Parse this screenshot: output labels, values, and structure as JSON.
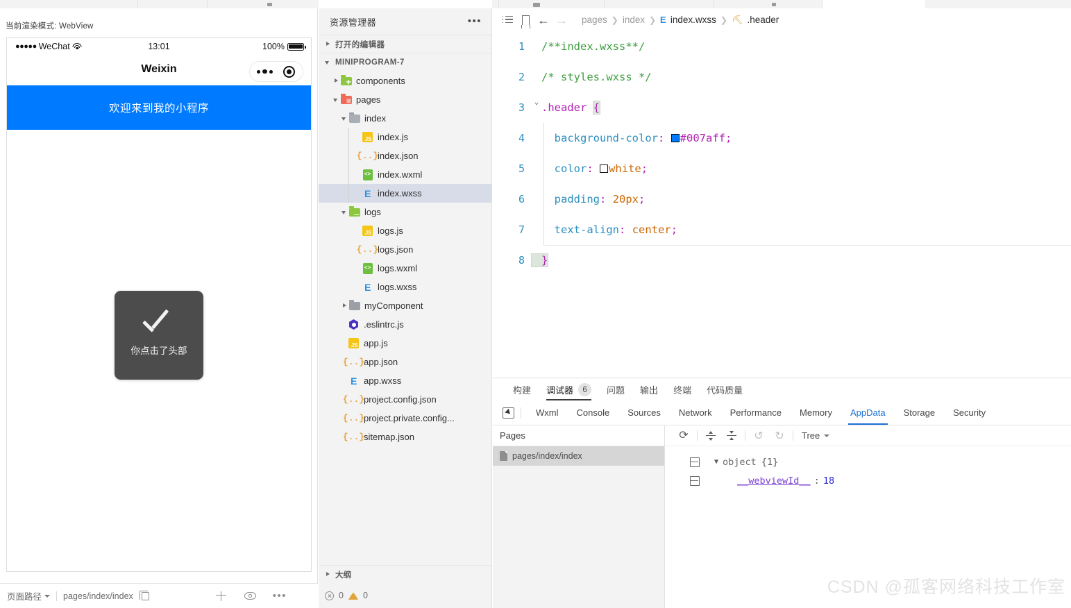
{
  "simulator": {
    "render_mode_label": "当前渲染模式: WebView",
    "status_bar": {
      "carrier": "WeChat",
      "dots": "●●●●●",
      "time": "13:01",
      "battery": "100%"
    },
    "nav_title": "Weixin",
    "header_banner": "欢迎来到我的小程序",
    "header_bg_color": "#007aff",
    "toast": {
      "icon": "check-icon",
      "text": "你点击了头部"
    },
    "bottom_bar": {
      "path_label": "页面路径",
      "path_value": "pages/index/index",
      "copy_icon": "copy-icon",
      "bug_icon": "bug-icon",
      "eye_icon": "eye-icon",
      "more_icon": "more-icon"
    }
  },
  "explorer": {
    "title": "资源管理器",
    "more_icon": "more-icon",
    "open_editors_label": "打开的编辑器",
    "project_label": "MINIPROGRAM-7",
    "outline_label": "大纲",
    "status": {
      "error_count": "0",
      "warning_count": "0"
    },
    "tree": [
      {
        "label": "components",
        "type": "folder",
        "icon": "folder-components-icon",
        "depth": 1,
        "expanded": false
      },
      {
        "label": "pages",
        "type": "folder",
        "icon": "folder-pages-icon",
        "depth": 1,
        "expanded": true
      },
      {
        "label": "index",
        "type": "folder",
        "icon": "folder-icon",
        "depth": 2,
        "expanded": true
      },
      {
        "label": "index.js",
        "type": "file",
        "icon": "js-icon",
        "depth": 3,
        "expanded": null
      },
      {
        "label": "index.json",
        "type": "file",
        "icon": "json-icon",
        "depth": 3,
        "expanded": null
      },
      {
        "label": "index.wxml",
        "type": "file",
        "icon": "wxml-icon",
        "depth": 3,
        "expanded": null
      },
      {
        "label": "index.wxss",
        "type": "file",
        "icon": "wxss-icon",
        "depth": 3,
        "expanded": null,
        "selected": true
      },
      {
        "label": "logs",
        "type": "folder",
        "icon": "folder-logs-icon",
        "depth": 2,
        "expanded": true
      },
      {
        "label": "logs.js",
        "type": "file",
        "icon": "js-icon",
        "depth": 3,
        "expanded": null
      },
      {
        "label": "logs.json",
        "type": "file",
        "icon": "json-icon",
        "depth": 3,
        "expanded": null
      },
      {
        "label": "logs.wxml",
        "type": "file",
        "icon": "wxml-icon",
        "depth": 3,
        "expanded": null
      },
      {
        "label": "logs.wxss",
        "type": "file",
        "icon": "wxss-icon",
        "depth": 3,
        "expanded": null
      },
      {
        "label": "myComponent",
        "type": "folder",
        "icon": "folder-icon",
        "depth": 2,
        "expanded": false
      },
      {
        "label": ".eslintrc.js",
        "type": "file",
        "icon": "eslint-icon",
        "depth": 1,
        "expanded": null
      },
      {
        "label": "app.js",
        "type": "file",
        "icon": "js-icon",
        "depth": 1,
        "expanded": null
      },
      {
        "label": "app.json",
        "type": "file",
        "icon": "json-icon",
        "depth": 1,
        "expanded": null
      },
      {
        "label": "app.wxss",
        "type": "file",
        "icon": "wxss-icon",
        "depth": 1,
        "expanded": null
      },
      {
        "label": "project.config.json",
        "type": "file",
        "icon": "json-icon",
        "depth": 1,
        "expanded": null
      },
      {
        "label": "project.private.config...",
        "type": "file",
        "icon": "json-icon",
        "depth": 1,
        "expanded": null
      },
      {
        "label": "sitemap.json",
        "type": "file",
        "icon": "json-icon",
        "depth": 1,
        "expanded": null
      }
    ]
  },
  "editor": {
    "toolbar_icons": [
      "list-icon",
      "bookmark-icon",
      "back-arrow-icon",
      "forward-arrow-icon"
    ],
    "breadcrumb": [
      {
        "label": "pages",
        "icon": null,
        "current": false
      },
      {
        "label": "index",
        "icon": null,
        "current": false
      },
      {
        "label": "index.wxss",
        "icon": "wxss-icon",
        "current": true
      },
      {
        "label": ".header",
        "icon": "css-rule-icon",
        "current": true
      }
    ],
    "lines": [
      {
        "num": "1",
        "text": "/**index.wxss**/"
      },
      {
        "num": "2",
        "text": "/* styles.wxss */"
      },
      {
        "num": "3",
        "text": ".header {"
      },
      {
        "num": "4",
        "text": "  background-color: #007aff;"
      },
      {
        "num": "5",
        "text": "  color: white;"
      },
      {
        "num": "6",
        "text": "  padding: 20px;"
      },
      {
        "num": "7",
        "text": "  text-align: center;"
      },
      {
        "num": "8",
        "text": "}"
      }
    ],
    "tokens": {
      "comment1": "/**index.wxss**/",
      "comment2": "/* styles.wxss */",
      "selector": ".header",
      "open_brace": "{",
      "close_brace": "}",
      "prop_bg": "background-color",
      "val_bg": "#007aff",
      "prop_color": "color",
      "val_color": "white",
      "prop_padding": "padding",
      "val_padding": "20px",
      "prop_align": "text-align",
      "val_align": "center",
      "colon": ":",
      "semicolon": ";",
      "swatch_bg_color": "#007aff",
      "swatch_white_color": "#ffffff"
    }
  },
  "debugger": {
    "panel_tabs": [
      {
        "label": "构建",
        "active": false,
        "badge": null
      },
      {
        "label": "调试器",
        "active": true,
        "badge": "6"
      },
      {
        "label": "问题",
        "active": false,
        "badge": null
      },
      {
        "label": "输出",
        "active": false,
        "badge": null
      },
      {
        "label": "终端",
        "active": false,
        "badge": null
      },
      {
        "label": "代码质量",
        "active": false,
        "badge": null
      }
    ],
    "devtools_tabs": [
      {
        "label": "Wxml",
        "active": false
      },
      {
        "label": "Console",
        "active": false
      },
      {
        "label": "Sources",
        "active": false
      },
      {
        "label": "Network",
        "active": false
      },
      {
        "label": "Performance",
        "active": false
      },
      {
        "label": "Memory",
        "active": false
      },
      {
        "label": "AppData",
        "active": true
      },
      {
        "label": "Storage",
        "active": false
      },
      {
        "label": "Security",
        "active": false
      }
    ],
    "inspect_icon": "inspect-cursor-icon",
    "pages": {
      "header": "Pages",
      "items": [
        {
          "label": "pages/index/index",
          "selected": true
        }
      ]
    },
    "data_toolbar": {
      "refresh_icon": "refresh-icon",
      "expand_icon": "expand-all-icon",
      "collapse_icon": "collapse-all-icon",
      "undo_icon": "undo-icon",
      "redo_icon": "redo-icon",
      "view_mode": "Tree"
    },
    "app_data": {
      "root_label": "object",
      "root_count": "{1}",
      "entry_key": "__webviewId__",
      "entry_colon": ":",
      "entry_value": "18"
    }
  },
  "watermark": "CSDN @孤客网络科技工作室"
}
